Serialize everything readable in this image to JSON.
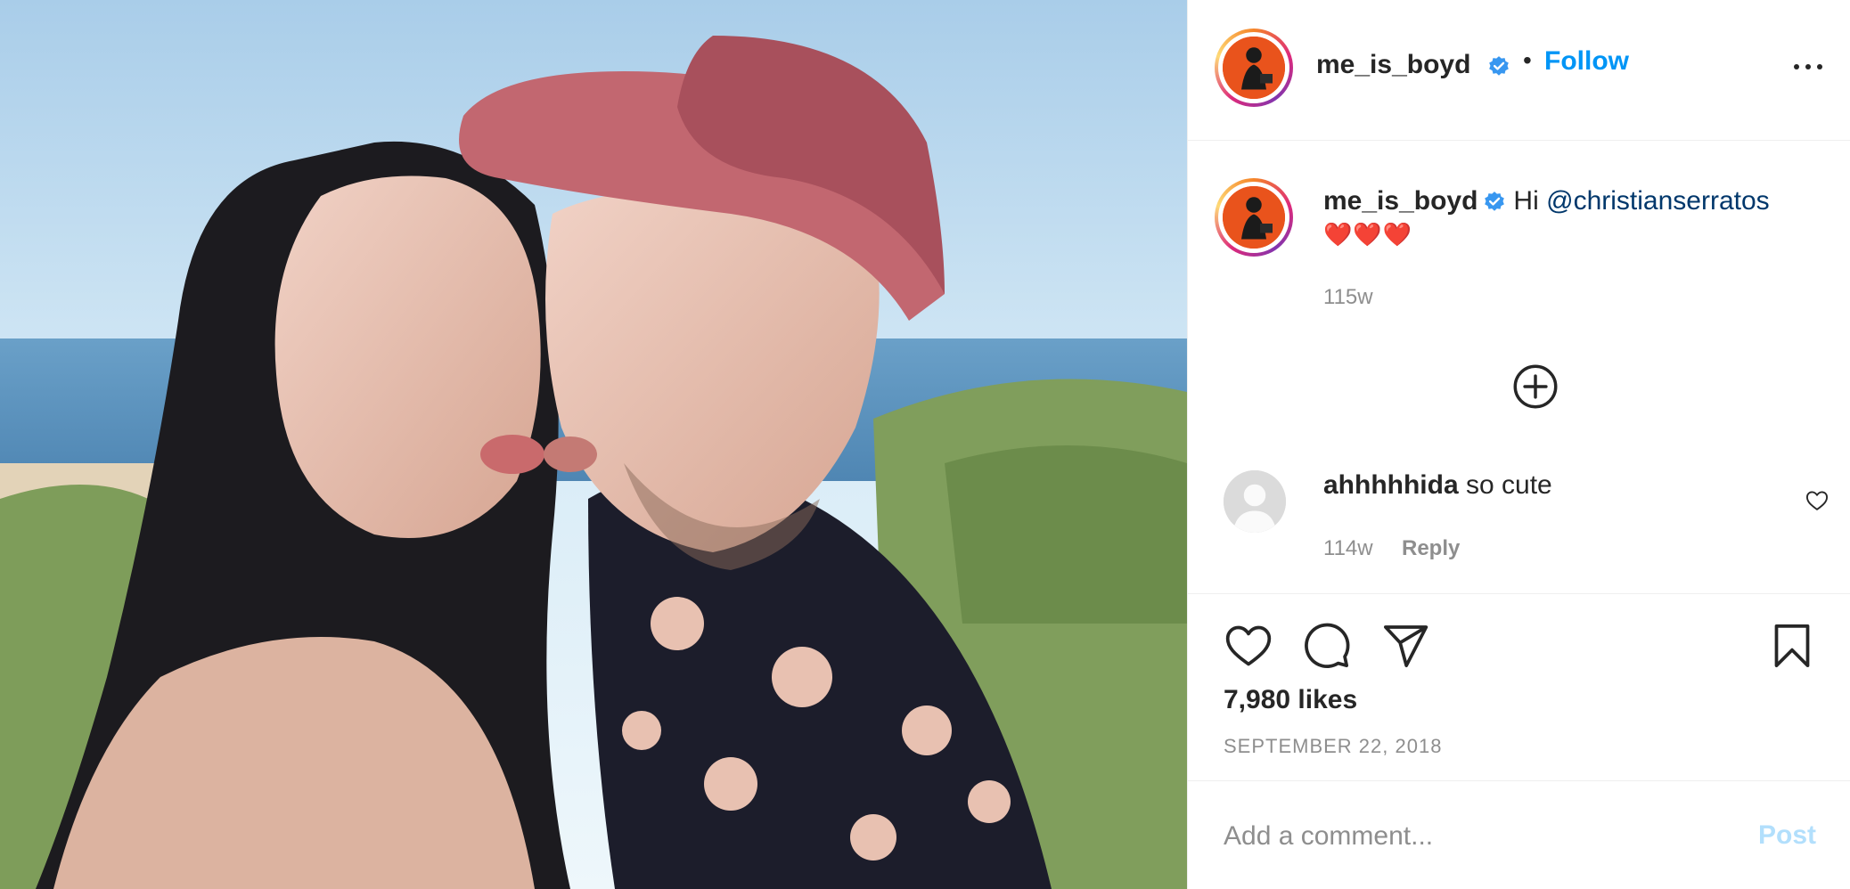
{
  "post": {
    "author": "me_is_boyd",
    "follow_label": "Follow",
    "separator": "•",
    "caption_greeting": "Hi",
    "caption_mention": "@christianserratos",
    "caption_emoji": "❤️❤️❤️",
    "caption_time": "115w",
    "likes": "7,980 likes",
    "date": "SEPTEMBER 22, 2018"
  },
  "comments": [
    {
      "user": "ahhhhhida",
      "text": "so cute",
      "time": "114w",
      "reply_label": "Reply"
    }
  ],
  "composer": {
    "placeholder": "Add a comment...",
    "post_label": "Post"
  },
  "colors": {
    "accent": "#0095f6",
    "verified": "#3897f0",
    "mention": "#00376b",
    "muted": "#8e8e8e",
    "post_disabled": "#b2dffc"
  },
  "icons": {
    "more": "more-options-icon",
    "verified": "verified-badge-icon",
    "load_more": "plus-circle-icon",
    "like": "heart-icon",
    "comment": "comment-bubble-icon",
    "share": "paper-plane-icon",
    "save": "bookmark-icon"
  }
}
